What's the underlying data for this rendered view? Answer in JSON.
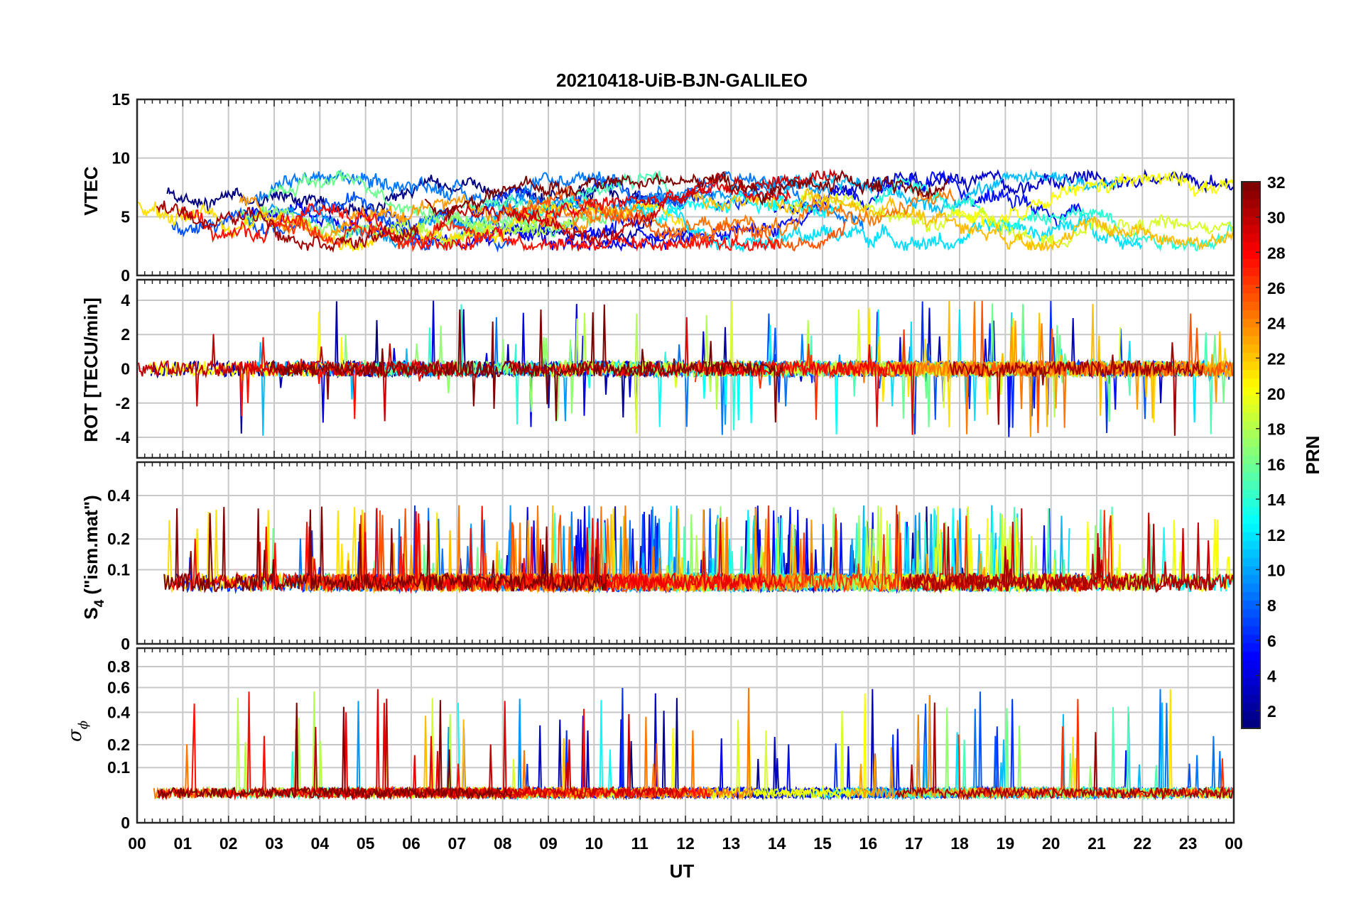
{
  "chart_data": [
    {
      "type": "line",
      "title": "20210418-UiB-BJN-GALILEO",
      "panel": "vtec",
      "ylabel": "VTEC",
      "ylim": [
        0,
        15
      ],
      "yticks": [
        0,
        5,
        10,
        15
      ],
      "xlim": [
        0,
        24
      ],
      "grid": true,
      "series_count": 30,
      "series_colored_by": "PRN",
      "typical_range": [
        2,
        10
      ]
    },
    {
      "type": "line",
      "panel": "rot",
      "ylabel": "ROT [TECU/min]",
      "ylim": [
        -5.2,
        5.2
      ],
      "yticks": [
        -4,
        -2,
        0,
        2,
        4
      ],
      "xlim": [
        0,
        24
      ],
      "grid": true,
      "typical_range": [
        -4.5,
        5
      ]
    },
    {
      "type": "line",
      "panel": "s4",
      "ylabel": "S4 (\"ism.mat\")",
      "ylabel_main": "S",
      "ylabel_sub": "4",
      "ylabel_rest": " (\"ism.mat\")",
      "ylim": [
        0,
        0.6
      ],
      "yscale": "power",
      "yticks": [
        0,
        0.1,
        0.2,
        0.4
      ],
      "xlim": [
        0,
        24
      ],
      "grid": true,
      "typical_range": [
        0.04,
        0.57
      ]
    },
    {
      "type": "line",
      "panel": "sigma_phi",
      "ylabel": "σφ",
      "ylabel_main": "σ",
      "ylabel_sub": "ϕ",
      "ylim": [
        0,
        1
      ],
      "yscale": "power",
      "yticks": [
        0,
        0.1,
        0.2,
        0.4,
        0.6,
        0.8
      ],
      "xlim": [
        0,
        24
      ],
      "grid": true,
      "typical_range": [
        0.01,
        1
      ]
    }
  ],
  "x_axis": {
    "label": "UT",
    "ticks": [
      "00",
      "01",
      "02",
      "03",
      "04",
      "05",
      "06",
      "07",
      "08",
      "09",
      "10",
      "11",
      "12",
      "13",
      "14",
      "15",
      "16",
      "17",
      "18",
      "19",
      "20",
      "21",
      "22",
      "23",
      "00"
    ]
  },
  "colorbar": {
    "label": "PRN",
    "range": [
      1,
      32
    ],
    "ticks": [
      2,
      4,
      6,
      8,
      10,
      12,
      14,
      16,
      18,
      20,
      22,
      24,
      26,
      28,
      30,
      32
    ],
    "colormap": "jet"
  }
}
